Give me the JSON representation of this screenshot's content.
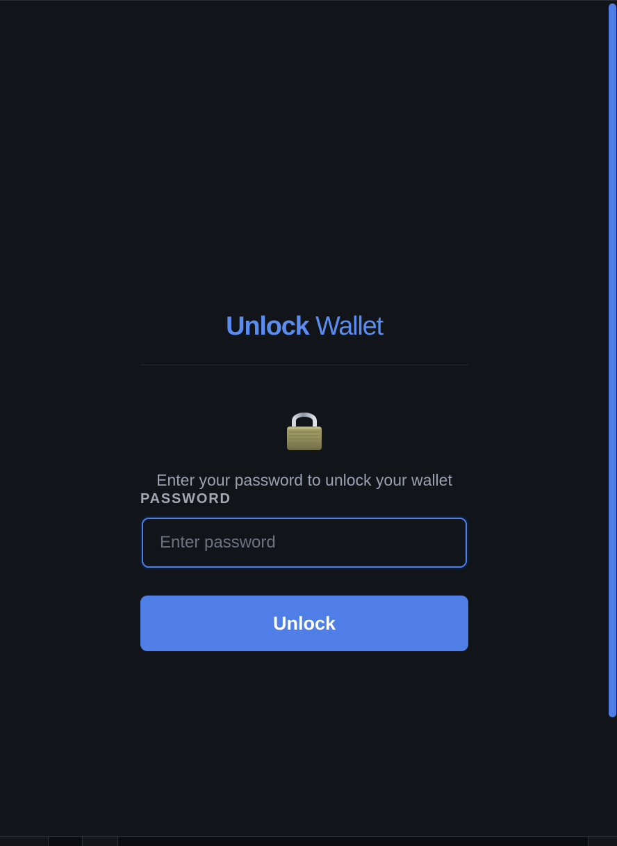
{
  "header": {
    "title_strong": "Unlock",
    "title_light": "Wallet"
  },
  "lock": {
    "icon": "padlock-icon"
  },
  "subtitle": "Enter your password to unlock your wallet",
  "password": {
    "label": "PASSWORD",
    "value": "",
    "placeholder": "Enter password"
  },
  "actions": {
    "unlock_label": "Unlock"
  },
  "colors": {
    "background": "#111419",
    "accent": "#4F7FE6",
    "title": "#5B8CF0",
    "muted_text": "#9AA2B2"
  }
}
